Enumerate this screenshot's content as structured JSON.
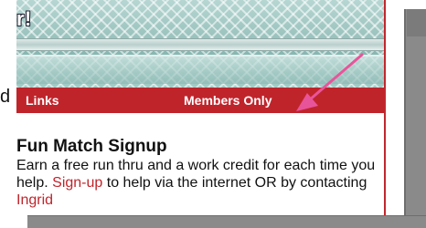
{
  "banner": {
    "title_fragment": "r!"
  },
  "side_fragment": "d",
  "nav": {
    "links_label": "Links",
    "members_label": "Members Only"
  },
  "content": {
    "title": "Fun Match Signup",
    "text_1": "Earn a free run thru and a work credit for each time you help. ",
    "signup_link": "Sign-up",
    "text_2": " to help via the internet OR by contacting ",
    "ingrid_link": "Ingrid"
  },
  "colors": {
    "nav_bg": "#c0242b",
    "link": "#c0242b",
    "arrow": "#e8549a",
    "banner": "#9fc7c2",
    "gray_panel": "#8a8a8a"
  }
}
